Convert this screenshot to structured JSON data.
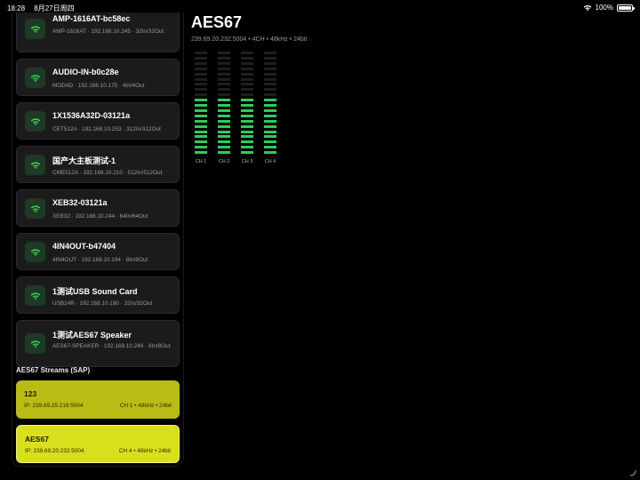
{
  "status_bar": {
    "time": "18:28",
    "date": "8月27日周四",
    "battery": "100%",
    "battery_level": 1.0
  },
  "devices": [
    {
      "name": "AMP-1616AT-bc58ec",
      "meta": "AMP-1616AT · 192.168.10.245 · 32In/32Out",
      "tall": true
    },
    {
      "name": "AUDIO-IN-b0c28e",
      "meta": "MOD4D · 192.168.10.175 · 4In/4Out",
      "tall": false
    },
    {
      "name": "1X1536A32D-03121a",
      "meta": "CET512A · 192.168.10.253 · 312In/312Out",
      "tall": false
    },
    {
      "name": "国产大主板测试-1",
      "meta": "CME512A · 192.168.10.210 · 512In/512Out",
      "tall": false
    },
    {
      "name": "XEB32-03121a",
      "meta": "XEB32 · 192.168.10.244 · 64In/64Out",
      "tall": false
    },
    {
      "name": "4IN4OUT-b47404",
      "meta": "4IN4OUT · 192.168.10.194 · 8In/8Out",
      "tall": false
    },
    {
      "name": "1测试USB Sound Card",
      "meta": "USB24R · 192.168.10.190 · 32In/32Out",
      "tall": false
    },
    {
      "name": "1测试AES67 Speaker",
      "meta": "AES67-SPEAKER · 192.168.10.249 · 8In/8Out",
      "tall": true
    }
  ],
  "streams_section": {
    "title": "AES67 Streams (SAP)",
    "streams": [
      {
        "name": "123",
        "ip": "IP: 239.69.25.216:5004",
        "info": "CH 1 • 48kHz • 24bit",
        "selected": false
      },
      {
        "name": "AES67",
        "ip": "IP: 239.69.20.232:5004",
        "info": "CH 4 • 48kHz • 24bit",
        "selected": true
      }
    ]
  },
  "detail": {
    "title": "AES67",
    "subtitle": "239.69.20.232:5004 • 4CH • 48kHz • 24bit",
    "meter_segments": 20,
    "channels": [
      {
        "label": "CH 1",
        "level": 0.55
      },
      {
        "label": "CH 2",
        "level": 0.55
      },
      {
        "label": "CH 3",
        "level": 0.55
      },
      {
        "label": "CH 4",
        "level": 0.55
      }
    ],
    "colors": {
      "meter_on": "#2ecc5a",
      "meter_off": "#1f1f1f"
    }
  },
  "colors": {
    "accent_stream": "#b9bc12",
    "accent_stream_selected": "#d8df1c",
    "wifi_icon": "#39d452"
  },
  "icons": {
    "device": "wifi-icon",
    "status_wifi": "wifi-icon",
    "resize": "resize-handle-icon"
  }
}
